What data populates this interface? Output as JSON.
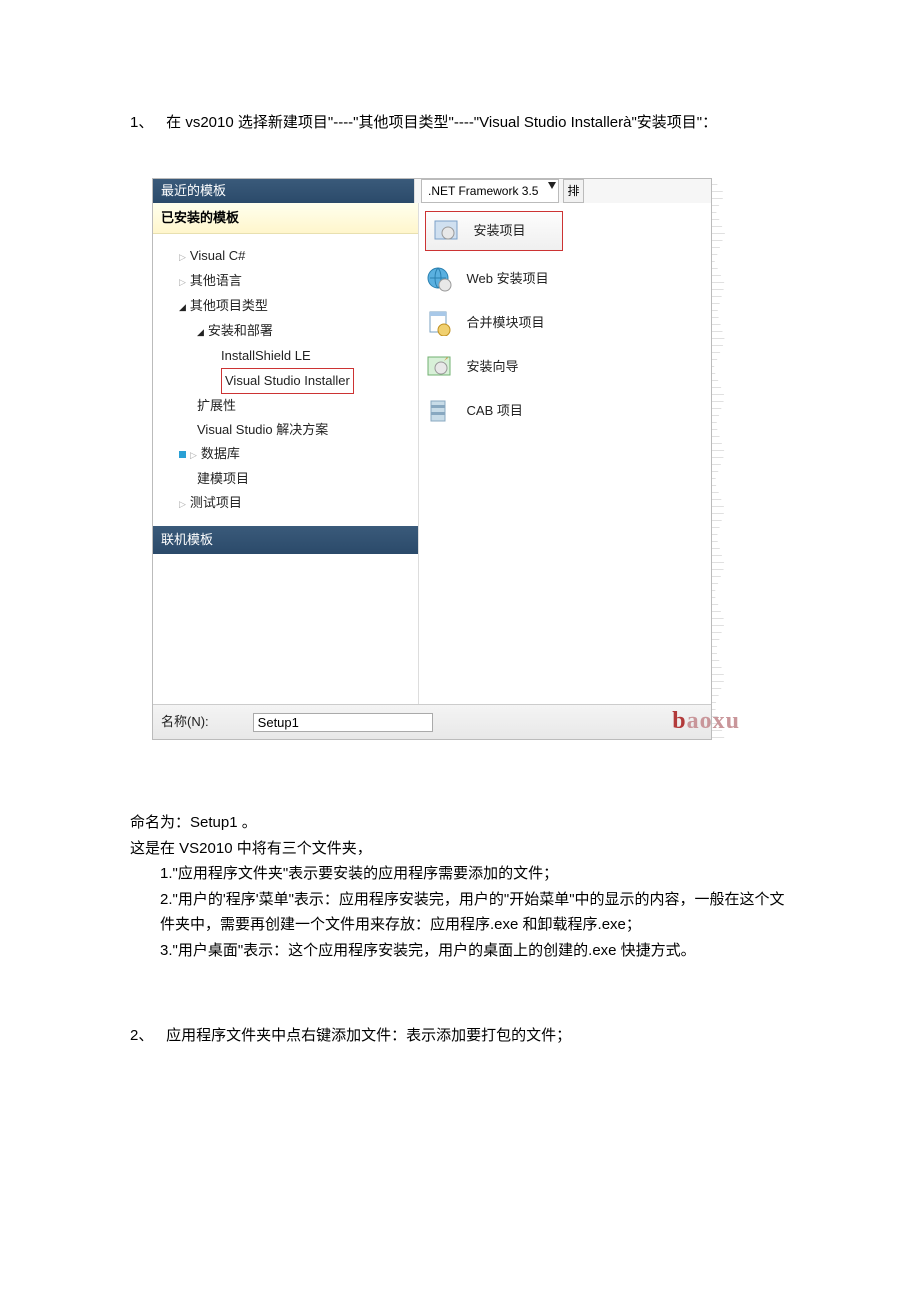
{
  "step1": {
    "number": "1、",
    "text_a": "在 vs2010 选择新建项目\"----\"其他项目类型\"----\"Visual Studio Installer",
    "text_arrow": "à",
    "text_b": "\"安装项目\"："
  },
  "vs_dialog": {
    "recent_header": "最近的模板",
    "installed_header": "已安装的模板",
    "framework_label": ".NET Framework 3.5",
    "sort_label": "排",
    "tree": {
      "visual_csharp": "Visual C#",
      "other_lang": "其他语言",
      "other_types": "其他项目类型",
      "setup_deploy": "安装和部署",
      "installshield": "InstallShield LE",
      "vs_installer": "Visual Studio Installer",
      "extensibility": "扩展性",
      "vs_solution": "Visual Studio 解决方案",
      "database": "数据库",
      "modeling": "建模项目",
      "test": "测试项目"
    },
    "online_header": "联机模板",
    "project_types": {
      "setup": "安装项目",
      "websetup": "Web 安装项目",
      "merge": "合并模块项目",
      "wizard": "安装向导",
      "cab": "CAB 项目"
    },
    "name_label": "名称(N):",
    "name_value": "Setup1"
  },
  "watermark": "aoxu",
  "watermark_b": "b",
  "after": {
    "rename": "命名为：Setup1 。",
    "folders_intro": "这是在 VS2010 中将有三个文件夹，",
    "f1": "1.\"应用程序文件夹\"表示要安装的应用程序需要添加的文件；",
    "f2": "2.\"用户的'程序'菜单\"表示：应用程序安装完，用户的\"开始菜单\"中的显示的内容，一般在这个文件夹中，需要再创建一个文件用来存放：应用程序.exe 和卸载程序.exe；",
    "f3": "3.\"用户桌面\"表示：这个应用程序安装完，用户的桌面上的创建的.exe 快捷方式。"
  },
  "step2": {
    "number": "2、",
    "text": "应用程序文件夹中点右键添加文件：表示添加要打包的文件；"
  }
}
